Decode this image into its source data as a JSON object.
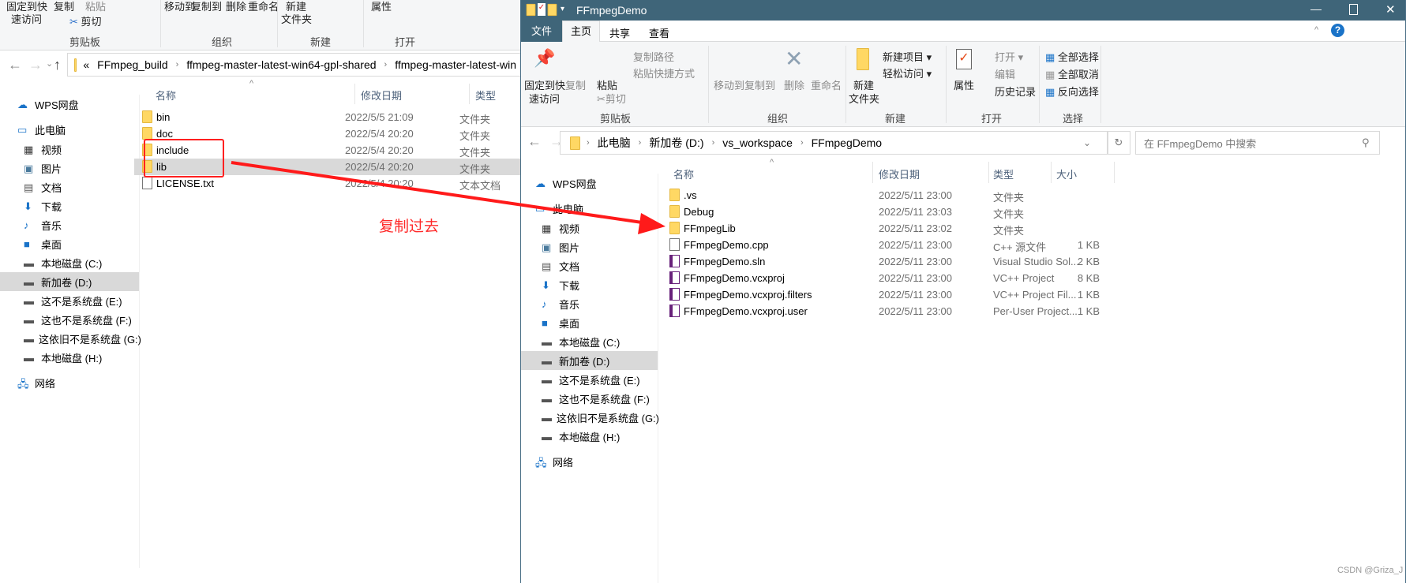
{
  "left_window": {
    "ribbon": {
      "pin": "固定到快",
      "pin2": "速访问",
      "copy": "复制",
      "paste": "粘贴",
      "cut": "剪切",
      "move_to": "移动到",
      "copy_to": "复制到",
      "delete": "删除",
      "rename": "重命名",
      "new_folder": "新建",
      "new_folder2": "文件夹",
      "properties": "属性",
      "groups": {
        "clipboard": "剪贴板",
        "organize": "组织",
        "new": "新建",
        "open": "打开"
      }
    },
    "breadcrumb": [
      "«",
      "FFmpeg_build",
      "ffmpeg-master-latest-win64-gpl-shared",
      "ffmpeg-master-latest-win"
    ],
    "nav": [
      {
        "label": "WPS网盘",
        "icon": "cloud-icon"
      },
      {
        "label": "此电脑",
        "icon": "computer-icon"
      },
      {
        "label": "视频",
        "icon": "video-icon"
      },
      {
        "label": "图片",
        "icon": "picture-icon"
      },
      {
        "label": "文档",
        "icon": "document-icon"
      },
      {
        "label": "下载",
        "icon": "download-icon"
      },
      {
        "label": "音乐",
        "icon": "music-icon"
      },
      {
        "label": "桌面",
        "icon": "desktop-icon"
      },
      {
        "label": "本地磁盘 (C:)",
        "icon": "drive-icon"
      },
      {
        "label": "新加卷 (D:)",
        "icon": "drive-icon",
        "selected": true
      },
      {
        "label": "这不是系统盘 (E:)",
        "icon": "drive-icon"
      },
      {
        "label": "这也不是系统盘 (F:)",
        "icon": "drive-icon"
      },
      {
        "label": "这依旧不是系统盘 (G:)",
        "icon": "drive-icon"
      },
      {
        "label": "本地磁盘 (H:)",
        "icon": "drive-icon"
      },
      {
        "label": "网络",
        "icon": "network-icon"
      }
    ],
    "columns": {
      "name": "名称",
      "date": "修改日期",
      "type": "类型"
    },
    "files": [
      {
        "name": "bin",
        "date": "2022/5/5 21:09",
        "type": "文件夹",
        "icon": "folder"
      },
      {
        "name": "doc",
        "date": "2022/5/4 20:20",
        "type": "文件夹",
        "icon": "folder"
      },
      {
        "name": "include",
        "date": "2022/5/4 20:20",
        "type": "文件夹",
        "icon": "folder"
      },
      {
        "name": "lib",
        "date": "2022/5/4 20:20",
        "type": "文件夹",
        "icon": "folder",
        "selected": true
      },
      {
        "name": "LICENSE.txt",
        "date": "2022/5/4 20:20",
        "type": "文本文档",
        "icon": "file"
      }
    ]
  },
  "right_window": {
    "title": "FFmpegDemo",
    "tabs": [
      "文件",
      "主页",
      "共享",
      "查看"
    ],
    "ribbon": {
      "pin": "固定到快",
      "pin2": "速访问",
      "copy": "复制",
      "paste": "粘贴",
      "copy_path": "复制路径",
      "paste_shortcut": "粘贴快捷方式",
      "cut": "剪切",
      "move_to": "移动到",
      "copy_to": "复制到",
      "delete": "删除",
      "rename": "重命名",
      "new_folder": "新建",
      "new_folder2": "文件夹",
      "new_item": "新建项目 ▾",
      "easy_access": "轻松访问 ▾",
      "properties": "属性",
      "open": "打开 ▾",
      "edit": "编辑",
      "history": "历史记录",
      "select_all": "全部选择",
      "select_none": "全部取消",
      "invert": "反向选择",
      "groups": {
        "clipboard": "剪贴板",
        "organize": "组织",
        "new": "新建",
        "open": "打开",
        "select": "选择"
      }
    },
    "breadcrumb": [
      "此电脑",
      "新加卷 (D:)",
      "vs_workspace",
      "FFmpegDemo"
    ],
    "search_placeholder": "在 FFmpegDemo 中搜索",
    "nav": [
      {
        "label": "WPS网盘"
      },
      {
        "label": "此电脑"
      },
      {
        "label": "视频"
      },
      {
        "label": "图片"
      },
      {
        "label": "文档"
      },
      {
        "label": "下载"
      },
      {
        "label": "音乐"
      },
      {
        "label": "桌面"
      },
      {
        "label": "本地磁盘 (C:)"
      },
      {
        "label": "新加卷 (D:)",
        "selected": true
      },
      {
        "label": "这不是系统盘 (E:)"
      },
      {
        "label": "这也不是系统盘 (F:)"
      },
      {
        "label": "这依旧不是系统盘 (G:)"
      },
      {
        "label": "本地磁盘 (H:)"
      },
      {
        "label": "网络"
      }
    ],
    "columns": {
      "name": "名称",
      "date": "修改日期",
      "type": "类型",
      "size": "大小"
    },
    "files": [
      {
        "name": ".vs",
        "date": "2022/5/11 23:00",
        "type": "文件夹",
        "size": "",
        "icon": "folder"
      },
      {
        "name": "Debug",
        "date": "2022/5/11 23:03",
        "type": "文件夹",
        "size": "",
        "icon": "folder"
      },
      {
        "name": "FFmpegLib",
        "date": "2022/5/11 23:02",
        "type": "文件夹",
        "size": "",
        "icon": "folder"
      },
      {
        "name": "FFmpegDemo.cpp",
        "date": "2022/5/11 23:00",
        "type": "C++ 源文件",
        "size": "1 KB",
        "icon": "file"
      },
      {
        "name": "FFmpegDemo.sln",
        "date": "2022/5/11 23:00",
        "type": "Visual Studio Sol...",
        "size": "2 KB",
        "icon": "vs"
      },
      {
        "name": "FFmpegDemo.vcxproj",
        "date": "2022/5/11 23:00",
        "type": "VC++ Project",
        "size": "8 KB",
        "icon": "vs"
      },
      {
        "name": "FFmpegDemo.vcxproj.filters",
        "date": "2022/5/11 23:00",
        "type": "VC++ Project Fil...",
        "size": "1 KB",
        "icon": "vs"
      },
      {
        "name": "FFmpegDemo.vcxproj.user",
        "date": "2022/5/11 23:00",
        "type": "Per-User Project...",
        "size": "1 KB",
        "icon": "vs"
      }
    ]
  },
  "annotation": {
    "text": "复制过去",
    "color": "#ff2a2a"
  },
  "watermark": "CSDN @Griza_J",
  "colors": {
    "titlebar": "#3f6579",
    "selection": "#d9d9d9",
    "accent": "#1a73c8"
  }
}
